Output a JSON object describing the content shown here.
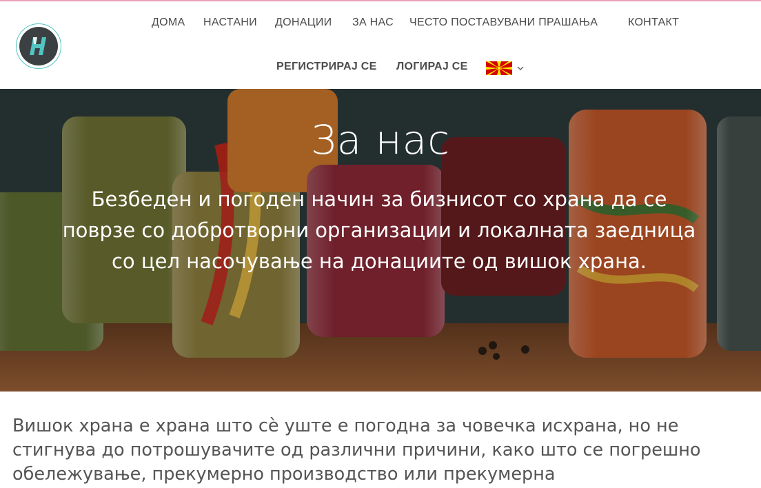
{
  "header": {
    "logo_alt": "logo",
    "nav": {
      "home": "ДОМА",
      "events": "НАСТАНИ",
      "donations": "ДОНАЦИИ",
      "about": "ЗА НАС",
      "faq": "ЧЕСТО ПОСТАВУВАНИ ПРАШАЊА",
      "contact": "КОНТАКТ"
    },
    "auth": {
      "register": "РЕГИСТРИРАЈ СЕ",
      "login": "ЛОГИРАЈ СЕ"
    },
    "language_icon": "flag-mk-icon"
  },
  "hero": {
    "title": "За нас",
    "subtitle": "Безбеден и погоден начин за бизнисот со храна да се поврзе со добротворни организации и локалната заедница со цел насочување на донациите од вишок храна."
  },
  "main": {
    "intro": "Вишок храна е храна што сѐ уште е погодна за човечка исхрана, но не стигнува до потрошувачите од различни причини, како што се погрешно обележување, прекумерно производство или прекумерна"
  },
  "colors": {
    "accent_teal": "#52c4c2",
    "logo_dark": "#3b4043",
    "top_bar": "#e9a2b7",
    "flag_red": "#d20000",
    "flag_yellow": "#ffe600"
  }
}
